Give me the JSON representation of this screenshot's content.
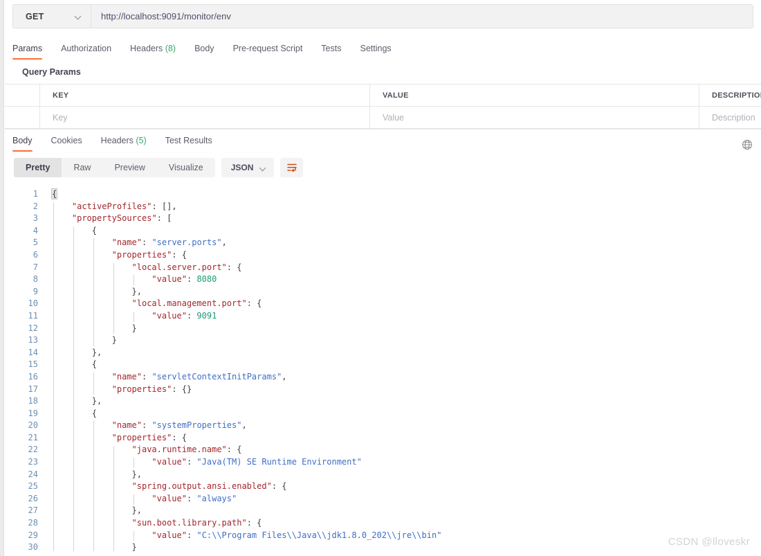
{
  "request": {
    "method": "GET",
    "method_icon": "chevron-down-icon",
    "url": "http://localhost:9091/monitor/env",
    "url_placeholder": "Enter request URL"
  },
  "request_tabs": [
    {
      "label": "Params",
      "active": true
    },
    {
      "label": "Authorization",
      "active": false
    },
    {
      "label": "Headers ",
      "count": "(8)",
      "active": false
    },
    {
      "label": "Body",
      "active": false
    },
    {
      "label": "Pre-request Script",
      "active": false
    },
    {
      "label": "Tests",
      "active": false
    },
    {
      "label": "Settings",
      "active": false
    }
  ],
  "params": {
    "section_label": "Query Params",
    "headers": [
      "KEY",
      "VALUE",
      "DESCRIPTION"
    ],
    "empty_row": {
      "key_placeholder": "Key",
      "value_placeholder": "Value",
      "description_placeholder": "Description"
    }
  },
  "response_tabs": [
    {
      "label": "Body",
      "active": true
    },
    {
      "label": "Cookies",
      "active": false
    },
    {
      "label": "Headers ",
      "count": "(5)",
      "active": false
    },
    {
      "label": "Test Results",
      "active": false
    }
  ],
  "response_toolbar": {
    "views": [
      {
        "label": "Pretty",
        "active": true
      },
      {
        "label": "Raw",
        "active": false
      },
      {
        "label": "Preview",
        "active": false
      },
      {
        "label": "Visualize",
        "active": false
      }
    ],
    "format": "JSON",
    "format_icon": "chevron-down-icon",
    "wrap_icon": "word-wrap-icon",
    "globe_icon": "globe-icon"
  },
  "watermark": "CSDN @lloveskr",
  "colors": {
    "accent": "#ff6c37",
    "json_key": "#a3262c",
    "json_string": "#3f6ec6",
    "json_number": "#1c9977",
    "line_number": "#6a8fb5",
    "count_green": "#3aa86b"
  },
  "body": {
    "language": "json",
    "lines": [
      {
        "n": 1,
        "indent": 0,
        "tokens": [
          {
            "t": "brk",
            "v": "{",
            "hl": true
          }
        ]
      },
      {
        "n": 2,
        "indent": 1,
        "tokens": [
          {
            "t": "key",
            "v": "\"activeProfiles\""
          },
          {
            "t": "pun",
            "v": ": "
          },
          {
            "t": "brk",
            "v": "[],"
          }
        ]
      },
      {
        "n": 3,
        "indent": 1,
        "tokens": [
          {
            "t": "key",
            "v": "\"propertySources\""
          },
          {
            "t": "pun",
            "v": ": "
          },
          {
            "t": "brk",
            "v": "["
          }
        ]
      },
      {
        "n": 4,
        "indent": 2,
        "tokens": [
          {
            "t": "brk",
            "v": "{"
          }
        ]
      },
      {
        "n": 5,
        "indent": 3,
        "tokens": [
          {
            "t": "key",
            "v": "\"name\""
          },
          {
            "t": "pun",
            "v": ": "
          },
          {
            "t": "str",
            "v": "\"server.ports\""
          },
          {
            "t": "pun",
            "v": ","
          }
        ]
      },
      {
        "n": 6,
        "indent": 3,
        "tokens": [
          {
            "t": "key",
            "v": "\"properties\""
          },
          {
            "t": "pun",
            "v": ": "
          },
          {
            "t": "brk",
            "v": "{"
          }
        ]
      },
      {
        "n": 7,
        "indent": 4,
        "tokens": [
          {
            "t": "key",
            "v": "\"local.server.port\""
          },
          {
            "t": "pun",
            "v": ": "
          },
          {
            "t": "brk",
            "v": "{"
          }
        ]
      },
      {
        "n": 8,
        "indent": 5,
        "tokens": [
          {
            "t": "key",
            "v": "\"value\""
          },
          {
            "t": "pun",
            "v": ": "
          },
          {
            "t": "num",
            "v": "8080"
          }
        ]
      },
      {
        "n": 9,
        "indent": 4,
        "tokens": [
          {
            "t": "brk",
            "v": "},"
          }
        ]
      },
      {
        "n": 10,
        "indent": 4,
        "tokens": [
          {
            "t": "key",
            "v": "\"local.management.port\""
          },
          {
            "t": "pun",
            "v": ": "
          },
          {
            "t": "brk",
            "v": "{"
          }
        ]
      },
      {
        "n": 11,
        "indent": 5,
        "tokens": [
          {
            "t": "key",
            "v": "\"value\""
          },
          {
            "t": "pun",
            "v": ": "
          },
          {
            "t": "num",
            "v": "9091"
          }
        ]
      },
      {
        "n": 12,
        "indent": 4,
        "tokens": [
          {
            "t": "brk",
            "v": "}"
          }
        ]
      },
      {
        "n": 13,
        "indent": 3,
        "tokens": [
          {
            "t": "brk",
            "v": "}"
          }
        ]
      },
      {
        "n": 14,
        "indent": 2,
        "tokens": [
          {
            "t": "brk",
            "v": "},"
          }
        ]
      },
      {
        "n": 15,
        "indent": 2,
        "tokens": [
          {
            "t": "brk",
            "v": "{"
          }
        ]
      },
      {
        "n": 16,
        "indent": 3,
        "tokens": [
          {
            "t": "key",
            "v": "\"name\""
          },
          {
            "t": "pun",
            "v": ": "
          },
          {
            "t": "str",
            "v": "\"servletContextInitParams\""
          },
          {
            "t": "pun",
            "v": ","
          }
        ]
      },
      {
        "n": 17,
        "indent": 3,
        "tokens": [
          {
            "t": "key",
            "v": "\"properties\""
          },
          {
            "t": "pun",
            "v": ": "
          },
          {
            "t": "brk",
            "v": "{}"
          }
        ]
      },
      {
        "n": 18,
        "indent": 2,
        "tokens": [
          {
            "t": "brk",
            "v": "},"
          }
        ]
      },
      {
        "n": 19,
        "indent": 2,
        "tokens": [
          {
            "t": "brk",
            "v": "{"
          }
        ]
      },
      {
        "n": 20,
        "indent": 3,
        "tokens": [
          {
            "t": "key",
            "v": "\"name\""
          },
          {
            "t": "pun",
            "v": ": "
          },
          {
            "t": "str",
            "v": "\"systemProperties\""
          },
          {
            "t": "pun",
            "v": ","
          }
        ]
      },
      {
        "n": 21,
        "indent": 3,
        "tokens": [
          {
            "t": "key",
            "v": "\"properties\""
          },
          {
            "t": "pun",
            "v": ": "
          },
          {
            "t": "brk",
            "v": "{"
          }
        ]
      },
      {
        "n": 22,
        "indent": 4,
        "tokens": [
          {
            "t": "key",
            "v": "\"java.runtime.name\""
          },
          {
            "t": "pun",
            "v": ": "
          },
          {
            "t": "brk",
            "v": "{"
          }
        ]
      },
      {
        "n": 23,
        "indent": 5,
        "tokens": [
          {
            "t": "key",
            "v": "\"value\""
          },
          {
            "t": "pun",
            "v": ": "
          },
          {
            "t": "str",
            "v": "\"Java(TM) SE Runtime Environment\""
          }
        ]
      },
      {
        "n": 24,
        "indent": 4,
        "tokens": [
          {
            "t": "brk",
            "v": "},"
          }
        ]
      },
      {
        "n": 25,
        "indent": 4,
        "tokens": [
          {
            "t": "key",
            "v": "\"spring.output.ansi.enabled\""
          },
          {
            "t": "pun",
            "v": ": "
          },
          {
            "t": "brk",
            "v": "{"
          }
        ]
      },
      {
        "n": 26,
        "indent": 5,
        "tokens": [
          {
            "t": "key",
            "v": "\"value\""
          },
          {
            "t": "pun",
            "v": ": "
          },
          {
            "t": "str",
            "v": "\"always\""
          }
        ]
      },
      {
        "n": 27,
        "indent": 4,
        "tokens": [
          {
            "t": "brk",
            "v": "},"
          }
        ]
      },
      {
        "n": 28,
        "indent": 4,
        "tokens": [
          {
            "t": "key",
            "v": "\"sun.boot.library.path\""
          },
          {
            "t": "pun",
            "v": ": "
          },
          {
            "t": "brk",
            "v": "{"
          }
        ]
      },
      {
        "n": 29,
        "indent": 5,
        "tokens": [
          {
            "t": "key",
            "v": "\"value\""
          },
          {
            "t": "pun",
            "v": ": "
          },
          {
            "t": "str",
            "v": "\"C:\\\\Program Files\\\\Java\\\\jdk1.8.0_202\\\\jre\\\\bin\""
          }
        ]
      },
      {
        "n": 30,
        "indent": 4,
        "tokens": [
          {
            "t": "brk",
            "v": "}"
          }
        ]
      }
    ]
  }
}
